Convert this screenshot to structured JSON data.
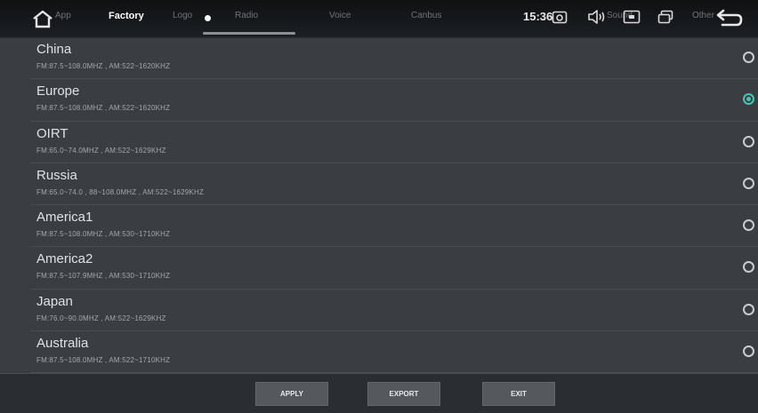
{
  "header": {
    "tabs": [
      {
        "label": "App"
      },
      {
        "label": "Factory"
      },
      {
        "label": "Logo"
      },
      {
        "label": "Radio"
      },
      {
        "label": "Voice"
      },
      {
        "label": "Canbus"
      },
      {
        "label": "Sound"
      },
      {
        "label": "Other"
      }
    ],
    "clock": "15:36",
    "icons": [
      "home-icon",
      "camera-icon",
      "volume-icon",
      "screen-icon",
      "windows-icon",
      "back-icon"
    ]
  },
  "regions": [
    {
      "name": "China",
      "range": "FM:87.5~108.0MHZ , AM:522~1620KHZ",
      "selected": false
    },
    {
      "name": "Europe",
      "range": "FM:87.5~108.0MHZ , AM:522~1620KHZ",
      "selected": true
    },
    {
      "name": "OIRT",
      "range": "FM:65.0~74.0MHZ , AM:522~1629KHZ",
      "selected": false
    },
    {
      "name": "Russia",
      "range": "FM:65.0~74.0 , 88~108.0MHZ , AM:522~1629KHZ",
      "selected": false
    },
    {
      "name": "America1",
      "range": "FM:87.5~108.0MHZ , AM:530~1710KHZ",
      "selected": false
    },
    {
      "name": "America2",
      "range": "FM:87.5~107.9MHZ , AM:530~1710KHZ",
      "selected": false
    },
    {
      "name": "Japan",
      "range": "FM:76.0~90.0MHZ , AM:522~1629KHZ",
      "selected": false
    },
    {
      "name": "Australia",
      "range": "FM:87.5~108.0MHZ , AM:522~1710KHZ",
      "selected": false
    }
  ],
  "footer": {
    "apply_label": "APPLY",
    "export_label": "EXPORT",
    "exit_label": "EXIT"
  },
  "colors": {
    "accent": "#3fc7b6",
    "background": "#3a3d42",
    "header": "#111315"
  }
}
